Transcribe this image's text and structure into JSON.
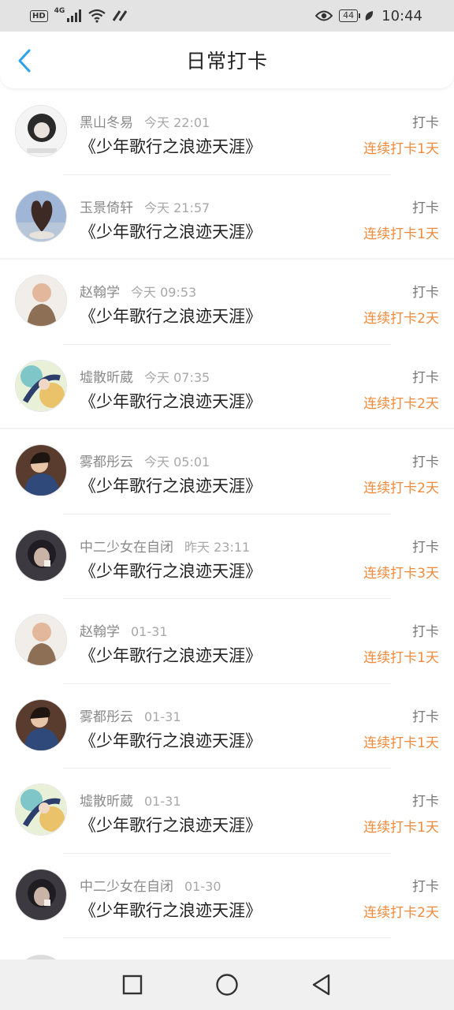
{
  "status_bar": {
    "hd": "HD",
    "network": "4G",
    "battery": "44",
    "time": "10:44",
    "icons": [
      "signal-icon",
      "wifi-icon",
      "eye-icon",
      "battery-icon",
      "leaf-icon"
    ]
  },
  "header": {
    "title": "日常打卡",
    "back_icon": "chevron-left-icon"
  },
  "colors": {
    "accent_blue": "#2aa3ec",
    "streak_orange": "#f08a3c"
  },
  "entries": [
    {
      "name": "黑山冬易",
      "time": "今天 22:01",
      "book": "《少年歌行之浪迹天涯》",
      "action": "打卡",
      "streak": "连续打卡1天"
    },
    {
      "name": "玉景倚轩",
      "time": "今天 21:57",
      "book": "《少年歌行之浪迹天涯》",
      "action": "打卡",
      "streak": "连续打卡1天"
    },
    {
      "name": "赵翰学",
      "time": "今天 09:53",
      "book": "《少年歌行之浪迹天涯》",
      "action": "打卡",
      "streak": "连续打卡2天"
    },
    {
      "name": "墟散昕葳",
      "time": "今天 07:35",
      "book": "《少年歌行之浪迹天涯》",
      "action": "打卡",
      "streak": "连续打卡2天"
    },
    {
      "name": "雾都彤云",
      "time": "今天 05:01",
      "book": "《少年歌行之浪迹天涯》",
      "action": "打卡",
      "streak": "连续打卡2天"
    },
    {
      "name": "中二少女在自闭",
      "time": "昨天 23:11",
      "book": "《少年歌行之浪迹天涯》",
      "action": "打卡",
      "streak": "连续打卡3天"
    },
    {
      "name": "赵翰学",
      "time": "01-31",
      "book": "《少年歌行之浪迹天涯》",
      "action": "打卡",
      "streak": "连续打卡1天"
    },
    {
      "name": "雾都彤云",
      "time": "01-31",
      "book": "《少年歌行之浪迹天涯》",
      "action": "打卡",
      "streak": "连续打卡1天"
    },
    {
      "name": "墟散昕葳",
      "time": "01-31",
      "book": "《少年歌行之浪迹天涯》",
      "action": "打卡",
      "streak": "连续打卡1天"
    },
    {
      "name": "中二少女在自闭",
      "time": "01-30",
      "book": "《少年歌行之浪迹天涯》",
      "action": "打卡",
      "streak": "连续打卡2天"
    }
  ],
  "nav": {
    "icons": [
      "recent-apps-icon",
      "home-icon",
      "back-triangle-icon"
    ]
  }
}
